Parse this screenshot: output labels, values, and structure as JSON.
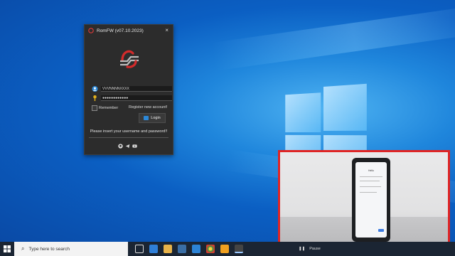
{
  "window": {
    "title": "RomFW (v07.10.2023)",
    "close_glyph": "×",
    "username_value": "VVVNNNNXXXX",
    "password_value": "●●●●●●●●●●●●",
    "remember_label": "Remember",
    "register_label": "Register new account!",
    "login_label": "Login",
    "message": "Please insert your username and password!!",
    "socials": [
      "github-icon",
      "telegram-icon",
      "youtube-icon"
    ]
  },
  "webcam": {
    "phone_title": "Hello"
  },
  "taskbar": {
    "search_placeholder": "Type here to search",
    "tray_text": "Pause"
  },
  "colors": {
    "accent_red": "#e02424",
    "window_bg": "#2c2c2c",
    "taskbar_bg": "#1b2533"
  }
}
